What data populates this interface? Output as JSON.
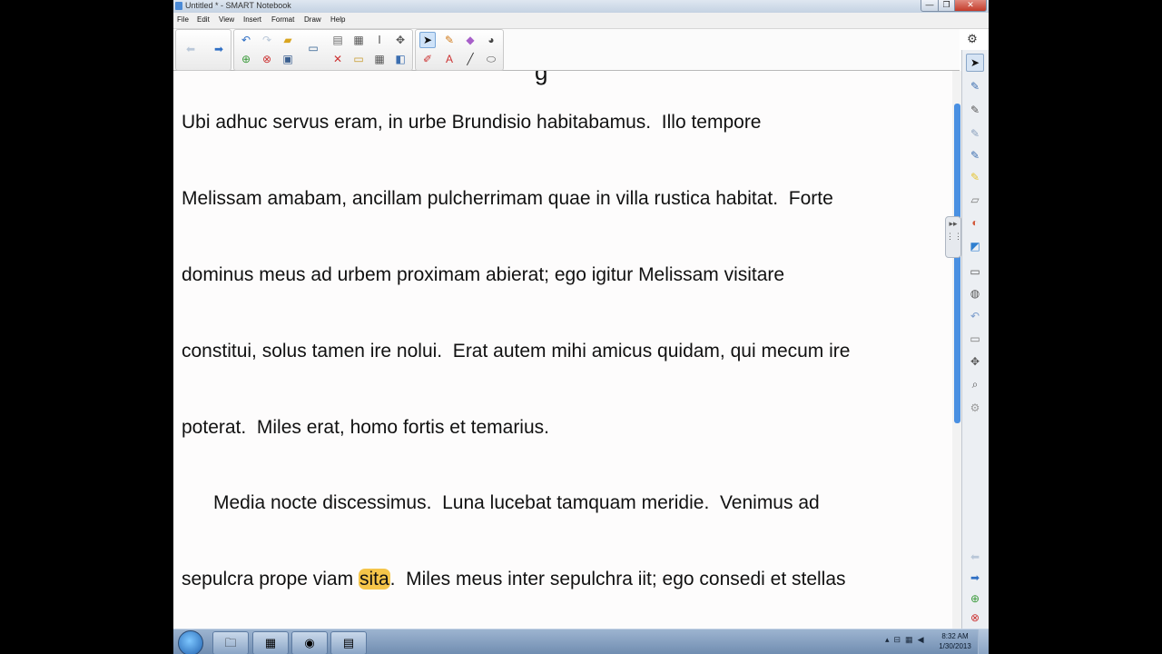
{
  "window": {
    "title": "Untitled * - SMART Notebook",
    "controls": {
      "minimize": "—",
      "maximize": "❐",
      "close": "✕"
    }
  },
  "menu": [
    "File",
    "Edit",
    "View",
    "Insert",
    "Format",
    "Draw",
    "Help"
  ],
  "toolbar": {
    "groups": [
      {
        "name": "navigation",
        "tools": [
          "back-arrow-icon",
          "forward-arrow-icon"
        ]
      },
      {
        "name": "document",
        "tools": [
          "undo-icon",
          "redo-icon",
          "open-folder-icon",
          "add-page-icon",
          "delete-icon",
          "save-icon",
          "screen-display-icon",
          "paste-icon",
          "cut-icon",
          "screen-shade-icon",
          "image-icon",
          "table-icon",
          "text-tool-icon",
          "capture-icon"
        ]
      },
      {
        "name": "drawing",
        "tools": [
          "select-arrow-icon",
          "pens-icon",
          "eraser-icon",
          "fill-icon",
          "creative-pens-icon",
          "text-icon",
          "line-icon",
          "shapes-icon"
        ]
      }
    ]
  },
  "document": {
    "heading_fragment": "g",
    "lines": [
      {
        "text": "Ubi adhuc servus eram, in urbe Brundisio habitabamus.  Illo tempore"
      },
      {
        "text": "Melissam amabam, ancillam pulcherrimam quae in villa rustica habitat.  Forte"
      },
      {
        "text": "dominus meus ad urbem proximam abierat; ego igitur Melissam visitare"
      },
      {
        "text": "constitui, solus tamen ire nolui.  Erat autem mihi amicus quidam, qui mecum ire"
      },
      {
        "text": "poterat.  Miles erat, homo fortis et temarius."
      },
      {
        "text": "      Media nocte discessimus.  Luna lucebat tamquam meridie.  Venimus ad"
      },
      {
        "pre": "sepulcra prope viam ",
        "highlighted": "sita",
        "post": ".  Miles meus inter sepulchra iit; ego consedi et stellas"
      }
    ],
    "highlight_color": "#f5c54a"
  },
  "side_panel": {
    "tools": [
      "select-icon",
      "pen-icon",
      "creative-pen-icon",
      "magic-pen-icon",
      "shape-pen-icon",
      "highlighter-icon",
      "eraser-icon",
      "fill-icon",
      "note-icon",
      "keyboard-icon",
      "pointer-icon",
      "undo-icon",
      "screen-shade-icon",
      "tool-icon",
      "magnifier-icon",
      "settings-icon",
      "prev-page-icon",
      "next-page-icon",
      "add-page-icon",
      "delete-page-icon"
    ]
  },
  "taskbar": {
    "apps": [
      "explorer",
      "notebook",
      "chrome",
      "network"
    ],
    "clock_time": "8:32 AM",
    "clock_date": "1/30/2013"
  },
  "colors": {
    "accent": "#4a90e2",
    "highlight": "#f5c54a",
    "taskbar": "#7f98b8"
  }
}
